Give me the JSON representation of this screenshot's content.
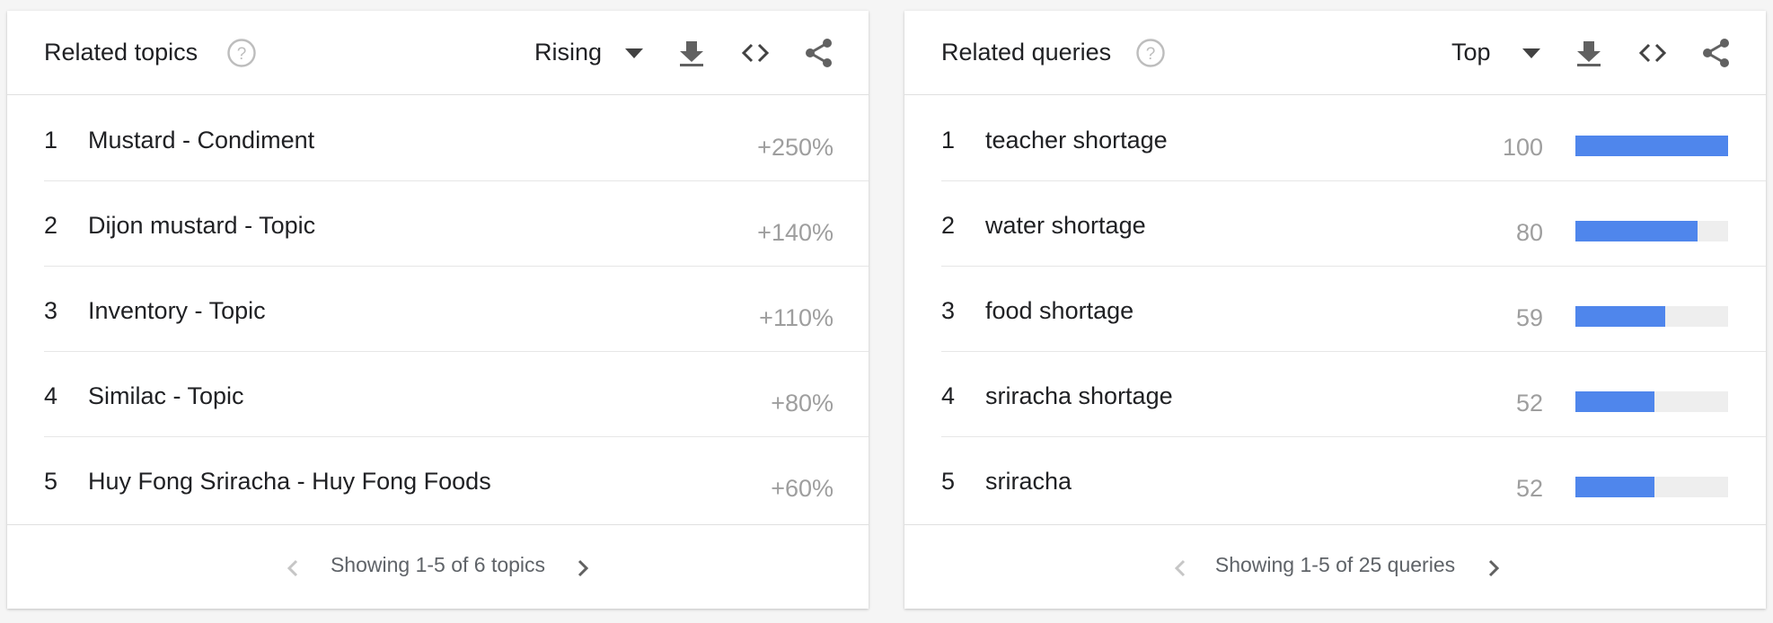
{
  "topics": {
    "title": "Related topics",
    "selector": "Rising",
    "rows": [
      {
        "rank": "1",
        "label": "Mustard - Condiment",
        "value": "+250%"
      },
      {
        "rank": "2",
        "label": "Dijon mustard - Topic",
        "value": "+140%"
      },
      {
        "rank": "3",
        "label": "Inventory - Topic",
        "value": "+110%"
      },
      {
        "rank": "4",
        "label": "Similac - Topic",
        "value": "+80%"
      },
      {
        "rank": "5",
        "label": "Huy Fong Sriracha - Huy Fong Foods",
        "value": "+60%"
      }
    ],
    "footer": "Showing 1-5 of 6 topics"
  },
  "queries": {
    "title": "Related queries",
    "selector": "Top",
    "rows": [
      {
        "rank": "1",
        "label": "teacher shortage",
        "value": "100",
        "fraction": 1.0
      },
      {
        "rank": "2",
        "label": "water shortage",
        "value": "80",
        "fraction": 0.8
      },
      {
        "rank": "3",
        "label": "food shortage",
        "value": "59",
        "fraction": 0.59
      },
      {
        "rank": "4",
        "label": "sriracha shortage",
        "value": "52",
        "fraction": 0.52
      },
      {
        "rank": "5",
        "label": "sriracha",
        "value": "52",
        "fraction": 0.52
      }
    ],
    "footer": "Showing 1-5 of 25 queries"
  },
  "icons": {
    "help": "help-circle-icon",
    "dropdown": "caret-down-icon",
    "download": "download-icon",
    "embed": "code-embed-icon",
    "share": "share-icon",
    "prev": "chevron-left-icon",
    "next": "chevron-right-icon"
  },
  "colors": {
    "bar": "#4f86ec",
    "bar_track": "#eeeeee",
    "muted_text": "#9e9e9e"
  }
}
